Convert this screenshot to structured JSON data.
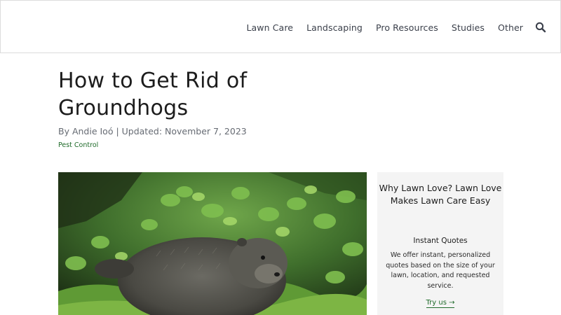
{
  "nav": {
    "items": [
      "Lawn Care",
      "Landscaping",
      "Pro Resources",
      "Studies",
      "Other"
    ],
    "search_icon": "search-icon"
  },
  "article": {
    "title": "How to Get Rid of Groundhogs",
    "byline": "By Andie Ioó | Updated: November 7, 2023",
    "category": "Pest Control"
  },
  "hero_image": {
    "subject": "groundhog-photo"
  },
  "sidebar_card": {
    "title": "Why Lawn Love? Lawn Love Makes Lawn Care Easy",
    "subtitle": "Instant Quotes",
    "body": "We offer instant, personalized quotes based on the size of your lawn, location, and requested service.",
    "cta": "Try us →",
    "accent_color": "#1f6b2a"
  }
}
